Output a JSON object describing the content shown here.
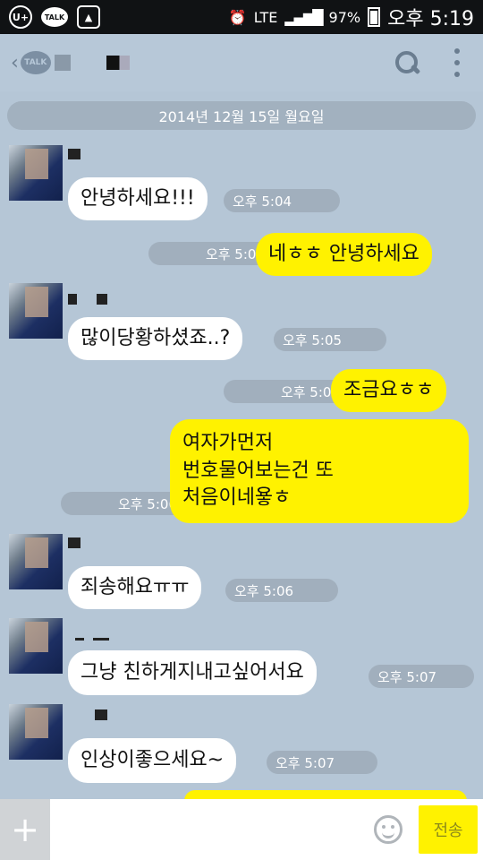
{
  "status_bar": {
    "left_icons": [
      "U+",
      "TALK",
      "gallery-icon"
    ],
    "network": "LTE",
    "battery": "97%",
    "time": "오후 5:19"
  },
  "header": {
    "talk_badge": "TALK"
  },
  "date_divider": "2014년 12월 15일 월요일",
  "messages": [
    {
      "dir": "in",
      "text": "안녕하세요!!!",
      "time": "오후 5:04"
    },
    {
      "dir": "out",
      "text": "네ㅎㅎ 안녕하세요",
      "time": "오후 5:04"
    },
    {
      "dir": "in",
      "text": "많이당황하셨죠..?",
      "time": "오후 5:05"
    },
    {
      "dir": "out",
      "text": "조금요ㅎㅎ",
      "time": "오후 5:05"
    },
    {
      "dir": "out",
      "lines": [
        "여자가먼저",
        "번호물어보는건 또",
        "처음이네욯ㅎ"
      ],
      "time": "오후 5:06"
    },
    {
      "dir": "in",
      "text": "죄송해요ㅠㅠ",
      "time": "오후 5:06"
    },
    {
      "dir": "in",
      "text": "그냥 친하게지내고싶어서요",
      "time": "오후 5:07"
    },
    {
      "dir": "in",
      "text": "인상이좋으세요~",
      "time": "오후 5:07"
    }
  ],
  "input_bar": {
    "plus": "+",
    "placeholder": "",
    "send_label": "전송"
  },
  "colors": {
    "background": "#b5c6d6",
    "outgoing_bubble": "#fff200",
    "incoming_bubble": "#ffffff"
  }
}
